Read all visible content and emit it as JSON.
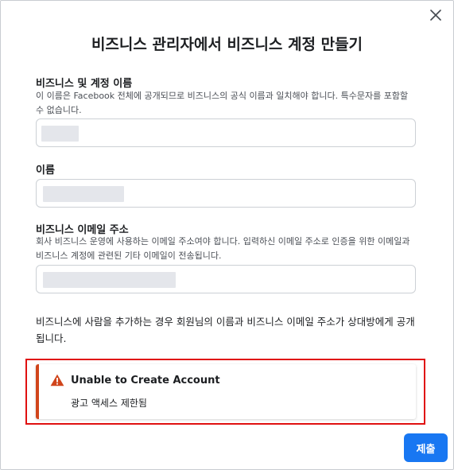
{
  "dialog": {
    "close_icon": "close-icon",
    "title": "비즈니스 관리자에서 비즈니스 계정 만들기"
  },
  "fields": {
    "business_name": {
      "label": "비즈니스 및 계정 이름",
      "help": "이 이름은 Facebook 전체에 공개되므로 비즈니스의 공식 이름과 일치해야 합니다. 특수문자를 포함할 수 없습니다."
    },
    "name": {
      "label": "이름"
    },
    "business_email": {
      "label": "비즈니스 이메일 주소",
      "help": "회사 비즈니스 운영에 사용하는 이메일 주소여야 합니다. 입력하신 이메일 주소로 인증을 위한 이메일과 비즈니스 계정에 관련된 기타 이메일이 전송됩니다."
    }
  },
  "notice": "비즈니스에 사람을 추가하는 경우 회원님의 이름과 비즈니스 이메일 주소가 상대방에게 공개됩니다.",
  "alert": {
    "icon": "warning-icon",
    "title": "Unable to Create Account",
    "message": "광고 액세스 제한됨",
    "color": "#d0451b"
  },
  "submit_label": "제출",
  "colors": {
    "primary": "#1877f2",
    "highlight_outline": "#e01010"
  }
}
